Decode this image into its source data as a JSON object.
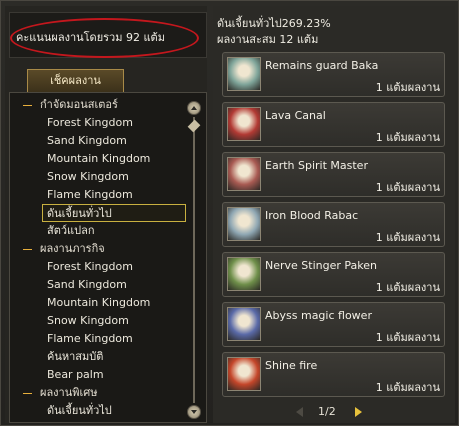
{
  "left": {
    "score_text": "คะแนนผลงานโดยรวม 92 แต้ม",
    "tab_label": "เช็คผลงาน",
    "tree": [
      {
        "kind": "cat",
        "label": "กำจัดมอนสเตอร์"
      },
      {
        "kind": "item",
        "label": "Forest Kingdom"
      },
      {
        "kind": "item",
        "label": "Sand Kingdom"
      },
      {
        "kind": "item",
        "label": "Mountain Kingdom"
      },
      {
        "kind": "item",
        "label": "Snow Kingdom"
      },
      {
        "kind": "item",
        "label": "Flame Kingdom"
      },
      {
        "kind": "selected",
        "label": "ดันเจี้ยนทั่วไป"
      },
      {
        "kind": "item",
        "label": "สัตว์แปลก"
      },
      {
        "kind": "cat",
        "label": "ผลงานภารกิจ"
      },
      {
        "kind": "item",
        "label": "Forest Kingdom"
      },
      {
        "kind": "item",
        "label": "Sand Kingdom"
      },
      {
        "kind": "item",
        "label": "Mountain Kingdom"
      },
      {
        "kind": "item",
        "label": "Snow Kingdom"
      },
      {
        "kind": "item",
        "label": "Flame Kingdom"
      },
      {
        "kind": "item",
        "label": "ค้นหาสมบัติ"
      },
      {
        "kind": "item",
        "label": "Bear palm"
      },
      {
        "kind": "cat",
        "label": "ผลงานพิเศษ"
      },
      {
        "kind": "item",
        "label": "ดันเจี้ยนทั่วไป"
      }
    ]
  },
  "right": {
    "summary_line1": "ดันเจี้ยนทั่วไป269.23%",
    "summary_line2": "ผลงานสะสม 12 แต้ม",
    "cards": [
      {
        "title": "Remains guard Baka",
        "points": "1 แต้มผลงาน",
        "icon": "remains-guard-baka-portrait",
        "color": "#7fa59a"
      },
      {
        "title": "Lava Canal",
        "points": "1 แต้มผลงาน",
        "icon": "lava-canal-portrait",
        "color": "#b23a34"
      },
      {
        "title": "Earth Spirit Master",
        "points": "1 แต้มผลงาน",
        "icon": "earth-spirit-master-portrait",
        "color": "#a85a52"
      },
      {
        "title": "Iron Blood Rabac",
        "points": "1 แต้มผลงาน",
        "icon": "iron-blood-rabac-portrait",
        "color": "#8fa7b3"
      },
      {
        "title": "Nerve Stinger Paken",
        "points": "1 แต้มผลงาน",
        "icon": "nerve-stinger-paken-portrait",
        "color": "#6f8f4a"
      },
      {
        "title": "Abyss magic flower",
        "points": "1 แต้มผลงาน",
        "icon": "abyss-magic-flower-portrait",
        "color": "#5a6aa8"
      },
      {
        "title": "Shine fire",
        "points": "1 แต้มผลงาน",
        "icon": "shine-fire-portrait",
        "color": "#c4462a"
      }
    ],
    "pager": "1/2"
  },
  "colors": {
    "highlight_oval": "#c4171d",
    "selected_border": "#c8b040",
    "category_dash": "#e8b03c"
  }
}
